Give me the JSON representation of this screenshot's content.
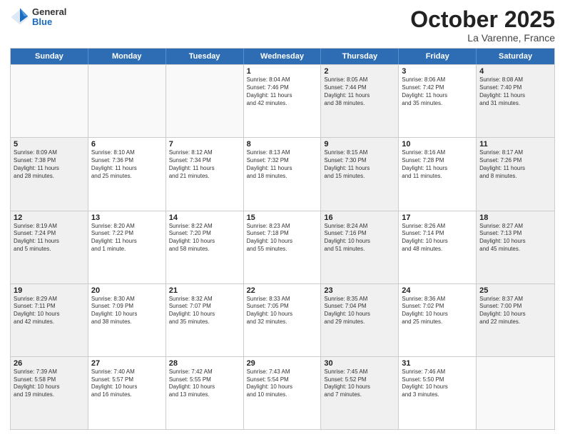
{
  "header": {
    "logo_general": "General",
    "logo_blue": "Blue",
    "title": "October 2025",
    "subtitle": "La Varenne, France"
  },
  "weekdays": [
    "Sunday",
    "Monday",
    "Tuesday",
    "Wednesday",
    "Thursday",
    "Friday",
    "Saturday"
  ],
  "rows": [
    [
      {
        "day": "",
        "info": "",
        "empty": true
      },
      {
        "day": "",
        "info": "",
        "empty": true
      },
      {
        "day": "",
        "info": "",
        "empty": true
      },
      {
        "day": "1",
        "info": "Sunrise: 8:04 AM\nSunset: 7:46 PM\nDaylight: 11 hours\nand 42 minutes.",
        "shaded": false
      },
      {
        "day": "2",
        "info": "Sunrise: 8:05 AM\nSunset: 7:44 PM\nDaylight: 11 hours\nand 38 minutes.",
        "shaded": true
      },
      {
        "day": "3",
        "info": "Sunrise: 8:06 AM\nSunset: 7:42 PM\nDaylight: 11 hours\nand 35 minutes.",
        "shaded": false
      },
      {
        "day": "4",
        "info": "Sunrise: 8:08 AM\nSunset: 7:40 PM\nDaylight: 11 hours\nand 31 minutes.",
        "shaded": true
      }
    ],
    [
      {
        "day": "5",
        "info": "Sunrise: 8:09 AM\nSunset: 7:38 PM\nDaylight: 11 hours\nand 28 minutes.",
        "shaded": true
      },
      {
        "day": "6",
        "info": "Sunrise: 8:10 AM\nSunset: 7:36 PM\nDaylight: 11 hours\nand 25 minutes.",
        "shaded": false
      },
      {
        "day": "7",
        "info": "Sunrise: 8:12 AM\nSunset: 7:34 PM\nDaylight: 11 hours\nand 21 minutes.",
        "shaded": false
      },
      {
        "day": "8",
        "info": "Sunrise: 8:13 AM\nSunset: 7:32 PM\nDaylight: 11 hours\nand 18 minutes.",
        "shaded": false
      },
      {
        "day": "9",
        "info": "Sunrise: 8:15 AM\nSunset: 7:30 PM\nDaylight: 11 hours\nand 15 minutes.",
        "shaded": true
      },
      {
        "day": "10",
        "info": "Sunrise: 8:16 AM\nSunset: 7:28 PM\nDaylight: 11 hours\nand 11 minutes.",
        "shaded": false
      },
      {
        "day": "11",
        "info": "Sunrise: 8:17 AM\nSunset: 7:26 PM\nDaylight: 11 hours\nand 8 minutes.",
        "shaded": true
      }
    ],
    [
      {
        "day": "12",
        "info": "Sunrise: 8:19 AM\nSunset: 7:24 PM\nDaylight: 11 hours\nand 5 minutes.",
        "shaded": true
      },
      {
        "day": "13",
        "info": "Sunrise: 8:20 AM\nSunset: 7:22 PM\nDaylight: 11 hours\nand 1 minute.",
        "shaded": false
      },
      {
        "day": "14",
        "info": "Sunrise: 8:22 AM\nSunset: 7:20 PM\nDaylight: 10 hours\nand 58 minutes.",
        "shaded": false
      },
      {
        "day": "15",
        "info": "Sunrise: 8:23 AM\nSunset: 7:18 PM\nDaylight: 10 hours\nand 55 minutes.",
        "shaded": false
      },
      {
        "day": "16",
        "info": "Sunrise: 8:24 AM\nSunset: 7:16 PM\nDaylight: 10 hours\nand 51 minutes.",
        "shaded": true
      },
      {
        "day": "17",
        "info": "Sunrise: 8:26 AM\nSunset: 7:14 PM\nDaylight: 10 hours\nand 48 minutes.",
        "shaded": false
      },
      {
        "day": "18",
        "info": "Sunrise: 8:27 AM\nSunset: 7:13 PM\nDaylight: 10 hours\nand 45 minutes.",
        "shaded": true
      }
    ],
    [
      {
        "day": "19",
        "info": "Sunrise: 8:29 AM\nSunset: 7:11 PM\nDaylight: 10 hours\nand 42 minutes.",
        "shaded": true
      },
      {
        "day": "20",
        "info": "Sunrise: 8:30 AM\nSunset: 7:09 PM\nDaylight: 10 hours\nand 38 minutes.",
        "shaded": false
      },
      {
        "day": "21",
        "info": "Sunrise: 8:32 AM\nSunset: 7:07 PM\nDaylight: 10 hours\nand 35 minutes.",
        "shaded": false
      },
      {
        "day": "22",
        "info": "Sunrise: 8:33 AM\nSunset: 7:05 PM\nDaylight: 10 hours\nand 32 minutes.",
        "shaded": false
      },
      {
        "day": "23",
        "info": "Sunrise: 8:35 AM\nSunset: 7:04 PM\nDaylight: 10 hours\nand 29 minutes.",
        "shaded": true
      },
      {
        "day": "24",
        "info": "Sunrise: 8:36 AM\nSunset: 7:02 PM\nDaylight: 10 hours\nand 25 minutes.",
        "shaded": false
      },
      {
        "day": "25",
        "info": "Sunrise: 8:37 AM\nSunset: 7:00 PM\nDaylight: 10 hours\nand 22 minutes.",
        "shaded": true
      }
    ],
    [
      {
        "day": "26",
        "info": "Sunrise: 7:39 AM\nSunset: 5:58 PM\nDaylight: 10 hours\nand 19 minutes.",
        "shaded": true
      },
      {
        "day": "27",
        "info": "Sunrise: 7:40 AM\nSunset: 5:57 PM\nDaylight: 10 hours\nand 16 minutes.",
        "shaded": false
      },
      {
        "day": "28",
        "info": "Sunrise: 7:42 AM\nSunset: 5:55 PM\nDaylight: 10 hours\nand 13 minutes.",
        "shaded": false
      },
      {
        "day": "29",
        "info": "Sunrise: 7:43 AM\nSunset: 5:54 PM\nDaylight: 10 hours\nand 10 minutes.",
        "shaded": false
      },
      {
        "day": "30",
        "info": "Sunrise: 7:45 AM\nSunset: 5:52 PM\nDaylight: 10 hours\nand 7 minutes.",
        "shaded": true
      },
      {
        "day": "31",
        "info": "Sunrise: 7:46 AM\nSunset: 5:50 PM\nDaylight: 10 hours\nand 3 minutes.",
        "shaded": false
      },
      {
        "day": "",
        "info": "",
        "empty": true
      }
    ]
  ]
}
